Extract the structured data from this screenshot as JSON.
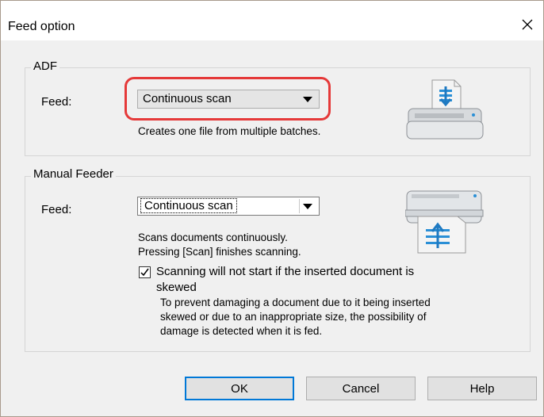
{
  "dialog": {
    "title": "Feed option",
    "close_icon": "close-icon"
  },
  "adf": {
    "group_label": "ADF",
    "feed_label": "Feed:",
    "feed_value": "Continuous scan",
    "description": "Creates one file from multiple batches.",
    "illustration_icon": "adf-scanner-icon",
    "highlight_color": "#e53939"
  },
  "manual": {
    "group_label": "Manual Feeder",
    "feed_label": "Feed:",
    "feed_value": "Continuous scan",
    "description_line1": "Scans documents continuously.",
    "description_line2": "Pressing [Scan] finishes scanning.",
    "illustration_icon": "manual-feeder-scanner-icon",
    "checkbox_checked": true,
    "checkbox_label_line1": "Scanning will not start if the inserted document is",
    "checkbox_label_line2": "skewed",
    "note_line1": "To prevent damaging a document due to it being inserted",
    "note_line2": "skewed or due to an inappropriate size, the possibility of",
    "note_line3": "damage is detected when it is fed."
  },
  "buttons": {
    "ok": "OK",
    "cancel": "Cancel",
    "help": "Help",
    "default_color": "#0078d7"
  }
}
